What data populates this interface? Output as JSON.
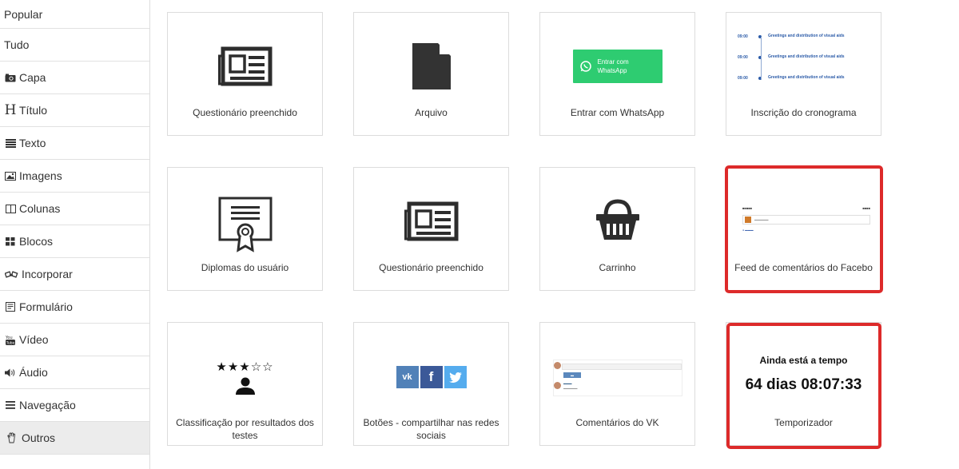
{
  "sidebar": {
    "items": [
      {
        "label": "Popular",
        "icon": ""
      },
      {
        "label": "Tudo",
        "icon": ""
      },
      {
        "label": "Capa",
        "icon": "camera-icon"
      },
      {
        "label": "Título",
        "icon": "heading-icon"
      },
      {
        "label": "Texto",
        "icon": "text-lines-icon"
      },
      {
        "label": "Imagens",
        "icon": "image-icon"
      },
      {
        "label": "Colunas",
        "icon": "columns-icon"
      },
      {
        "label": "Blocos",
        "icon": "blocks-icon"
      },
      {
        "label": "Incorporar",
        "icon": "embed-icon"
      },
      {
        "label": "Formulário",
        "icon": "form-icon"
      },
      {
        "label": "Vídeo",
        "icon": "youtube-icon"
      },
      {
        "label": "Áudio",
        "icon": "speaker-icon"
      },
      {
        "label": "Navegação",
        "icon": "menu-icon"
      },
      {
        "label": "Outros",
        "icon": "hand-icon"
      }
    ],
    "active": "Outros"
  },
  "cards": [
    {
      "caption": "Questionário preenchido",
      "icon": "newspaper-icon"
    },
    {
      "caption": "Arquivo",
      "icon": "file-icon"
    },
    {
      "caption": "Entrar com WhatsApp",
      "icon": "whatsapp-icon",
      "button_text": "Entrar com\nWhatsApp"
    },
    {
      "caption": "Inscrição do cronograma",
      "icon": "schedule-preview",
      "schedule": [
        {
          "time": "09:00",
          "title": "Greetings and distribution of visual aids"
        },
        {
          "time": "09:00",
          "title": "Greetings and distribution of visual aids"
        },
        {
          "time": "09:00",
          "title": "Greetings and distribution of visual aids"
        }
      ]
    },
    {
      "caption": "Diplomas do usuário",
      "icon": "certificate-icon"
    },
    {
      "caption": "Questionário preenchido",
      "icon": "newspaper-icon"
    },
    {
      "caption": "Carrinho",
      "icon": "basket-icon"
    },
    {
      "caption": "Feed de comentários do Facebo",
      "icon": "facebook-comments-preview"
    },
    {
      "caption": "Classificação por resultados dos testes",
      "icon": "rating-user-icon"
    },
    {
      "caption": "Botões - compartilhar nas redes sociais",
      "icon": "share-buttons-icon"
    },
    {
      "caption": "Comentários do VK",
      "icon": "vk-comments-preview"
    },
    {
      "caption": "Temporizador",
      "icon": "timer-preview",
      "timer_title": "Ainda está a tempo",
      "timer_value": "64 dias 08:07:33"
    }
  ],
  "colors": {
    "highlight": "#dd2a2a",
    "whatsapp": "#2ecc71",
    "vk": "#4a76a8",
    "active_sidebar": "#ececec"
  }
}
